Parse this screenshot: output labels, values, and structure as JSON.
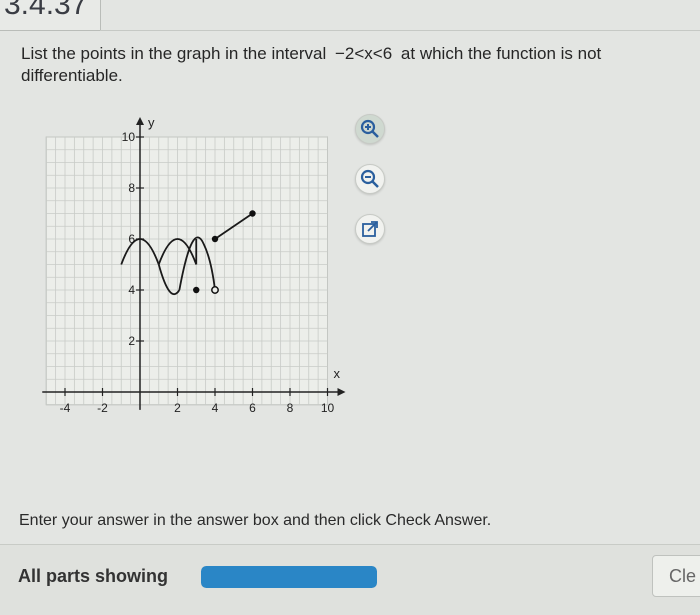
{
  "header": {
    "exercise_number": "3.4.37"
  },
  "question": {
    "text_before": "List the points in the graph in the interval",
    "interval": "−2<x<6",
    "text_after": "at which the function is not differentiable."
  },
  "graph": {
    "y_axis_label": "y",
    "x_axis_label": "x",
    "x_ticks": [
      "-4",
      "-2",
      "2",
      "4",
      "6",
      "8",
      "10"
    ],
    "y_ticks": [
      "2",
      "4",
      "6",
      "8",
      "10"
    ],
    "segments": [
      {
        "kind": "arc",
        "from": [
          -1,
          5
        ],
        "peak": [
          0,
          6
        ],
        "to": [
          1,
          5
        ]
      },
      {
        "kind": "arc",
        "from": [
          1,
          5
        ],
        "peak": [
          2,
          6
        ],
        "to": [
          3,
          5
        ]
      },
      {
        "kind": "line",
        "from": [
          3,
          5
        ],
        "to": [
          3,
          6
        ]
      },
      {
        "kind": "line",
        "from": [
          4,
          6
        ],
        "to": [
          6,
          7
        ]
      }
    ],
    "filled_points": [
      [
        3,
        4
      ],
      [
        4,
        6
      ],
      [
        6,
        7
      ]
    ],
    "open_points": [
      [
        4,
        4
      ]
    ]
  },
  "tools": [
    {
      "name": "zoom-in",
      "icon": "zoom-in-icon"
    },
    {
      "name": "zoom-out",
      "icon": "zoom-out-icon"
    },
    {
      "name": "open-external",
      "icon": "external-link-icon"
    }
  ],
  "instruction": "Enter your answer in the answer box and then click Check Answer.",
  "footer": {
    "parts_label": "All parts showing",
    "progress": 1.0,
    "clear_label": "Cle"
  },
  "colors": {
    "progress_fill": "#2a86c6",
    "curve": "#1a1a1a",
    "grid": "#c8cbc7"
  }
}
